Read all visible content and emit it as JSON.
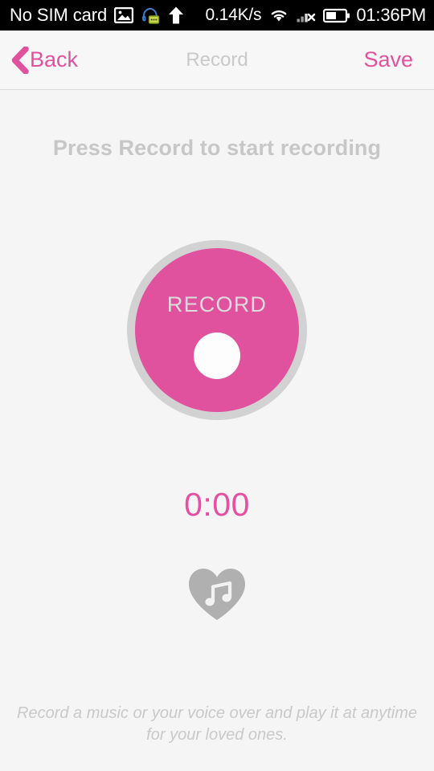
{
  "status_bar": {
    "carrier": "No SIM card",
    "network_speed": "0.14K/s",
    "time": "01:36PM",
    "icons": {
      "gallery": "gallery-icon",
      "message_headset": "message-headset-icon",
      "upload_arrow": "upload-arrow-icon",
      "wifi": "wifi-icon",
      "signal_off": "signal-no-service-icon",
      "battery": "battery-icon"
    },
    "background_color": "#000000",
    "text_color": "#ffffff"
  },
  "nav_bar": {
    "back_label": "Back",
    "back_icon": "chevron-left-icon",
    "title": "Record",
    "save_label": "Save",
    "accent_color": "#e0529e",
    "title_color": "#c9c9c9"
  },
  "main": {
    "headline": "Press Record to start recording",
    "record_button": {
      "label": "RECORD",
      "fill_color": "#e0529e",
      "ring_color": "#d2d2d2",
      "label_color": "#dcdcdc",
      "dot_color": "#ffffff"
    },
    "timer": {
      "value": "0:00",
      "color": "#e64fa2"
    },
    "heart_icon": {
      "name": "heart-music-icon",
      "color": "#b0b0b0",
      "note_color": "#f5f5f5"
    },
    "footer_note": "Record a music or your voice over and play it at anytime for your loved ones.",
    "background_color": "#f5f5f5"
  }
}
